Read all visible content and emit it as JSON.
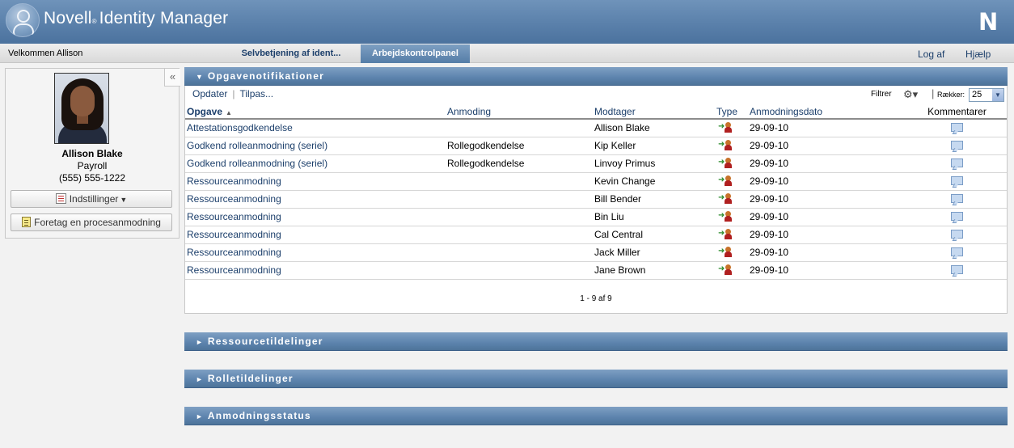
{
  "header": {
    "brand": "Novell",
    "reg": "®",
    "product": "Identity Manager",
    "logo_letter": "N"
  },
  "nav": {
    "welcome": "Velkommen Allison",
    "tabs": [
      {
        "label": "Selvbetjening af ident...",
        "active": false
      },
      {
        "label": "Arbejdskontrolpanel",
        "active": true
      }
    ],
    "logout": "Log af",
    "help": "Hjælp"
  },
  "profile": {
    "collapse_glyph": "«",
    "name": "Allison Blake",
    "department": "Payroll",
    "phone": "(555) 555-1222",
    "settings_label": "Indstillinger",
    "process_label": "Foretag en procesanmodning"
  },
  "tasks": {
    "title": "Opgavenotifikationer",
    "toolbar": {
      "refresh": "Opdater",
      "customize": "Tilpas..."
    },
    "filter_label": "Filtrer",
    "rows_label": "Rækker:",
    "rows_value": "25",
    "columns": [
      "Opgave",
      "Anmoding",
      "Modtager",
      "Type",
      "Anmodningsdato",
      "Kommentarer"
    ],
    "rows": [
      {
        "task": "Attestationsgodkendelse",
        "request": "",
        "recipient": "Allison Blake",
        "date": "29-09-10"
      },
      {
        "task": "Godkend rolleanmodning (seriel)",
        "request": "Rollegodkendelse",
        "recipient": "Kip Keller",
        "date": "29-09-10"
      },
      {
        "task": "Godkend rolleanmodning (seriel)",
        "request": "Rollegodkendelse",
        "recipient": "Linvoy Primus",
        "date": "29-09-10"
      },
      {
        "task": "Ressourceanmodning",
        "request": "",
        "recipient": "Kevin Change",
        "date": "29-09-10"
      },
      {
        "task": "Ressourceanmodning",
        "request": "",
        "recipient": "Bill Bender",
        "date": "29-09-10"
      },
      {
        "task": "Ressourceanmodning",
        "request": "",
        "recipient": "Bin Liu",
        "date": "29-09-10"
      },
      {
        "task": "Ressourceanmodning",
        "request": "",
        "recipient": "Cal Central",
        "date": "29-09-10"
      },
      {
        "task": "Ressourceanmodning",
        "request": "",
        "recipient": "Jack Miller",
        "date": "29-09-10"
      },
      {
        "task": "Ressourceanmodning",
        "request": "",
        "recipient": "Jane Brown",
        "date": "29-09-10"
      }
    ],
    "pager": "1 - 9 af 9"
  },
  "sections": [
    {
      "title": "Ressourcetildelinger"
    },
    {
      "title": "Rolletildelinger"
    },
    {
      "title": "Anmodningsstatus"
    }
  ],
  "colors": {
    "header_blue": "#5c82ac",
    "link_blue": "#1c3f6b",
    "active_tab": "#557da7"
  }
}
